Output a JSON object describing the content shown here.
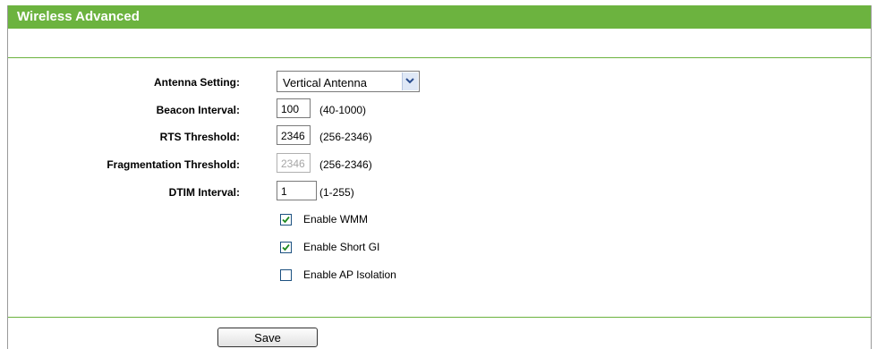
{
  "page": {
    "title": "Wireless Advanced"
  },
  "form": {
    "antenna": {
      "label": "Antenna Setting:",
      "value": "Vertical Antenna"
    },
    "beacon": {
      "label": "Beacon Interval:",
      "value": "100",
      "range": "(40-1000)"
    },
    "rts": {
      "label": "RTS Threshold:",
      "value": "2346",
      "range": "(256-2346)"
    },
    "fragmentation": {
      "label": "Fragmentation Threshold:",
      "value": "2346",
      "range": "(256-2346)"
    },
    "dtim": {
      "label": "DTIM Interval:",
      "value": "1",
      "range": "(1-255)"
    },
    "checkboxes": [
      {
        "label": "Enable WMM",
        "checked": true
      },
      {
        "label": "Enable Short GI",
        "checked": true
      },
      {
        "label": "Enable AP Isolation",
        "checked": false
      }
    ]
  },
  "actions": {
    "save_label": "Save"
  },
  "colors": {
    "accent": "#6cb33f",
    "checkbox_border": "#1c5180",
    "checkmark": "#1e8a1e"
  },
  "icons": {
    "select_arrow": "chevron-down-icon",
    "check": "checkmark-icon"
  }
}
